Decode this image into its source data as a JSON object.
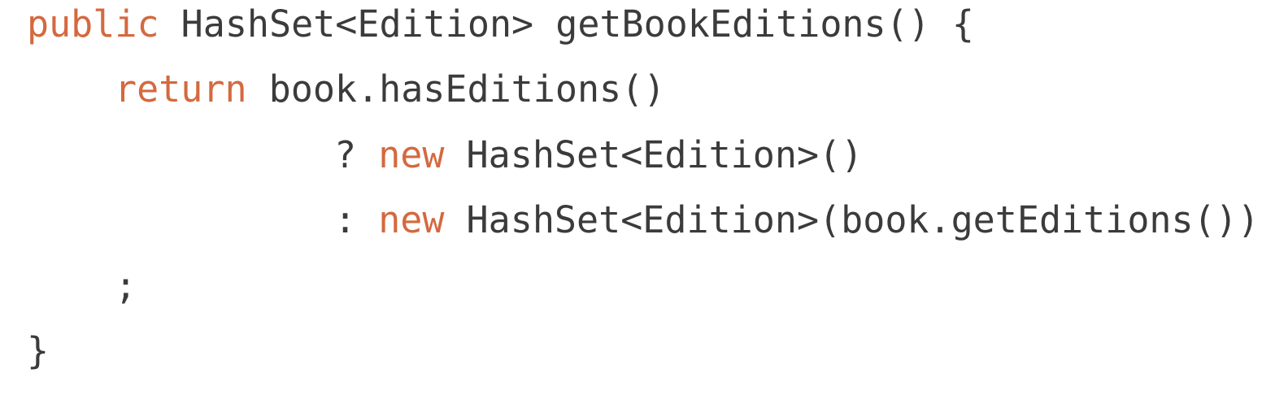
{
  "code": {
    "language": "Java",
    "keyword_color": "#d4693f",
    "text_color": "#3b3b3b",
    "line1": {
      "kw_public": "public",
      "rest": " HashSet<Edition> getBookEditions() {"
    },
    "line2": {
      "kw_return": "return",
      "rest": " book.hasEditions()"
    },
    "line3": {
      "prefix": "? ",
      "kw_new": "new",
      "rest": " HashSet<Edition>()"
    },
    "line4": {
      "prefix": ": ",
      "kw_new": "new",
      "rest": " HashSet<Edition>(book.getEditions())"
    },
    "line5": {
      "text": ";"
    },
    "line6": {
      "text": "}"
    }
  }
}
